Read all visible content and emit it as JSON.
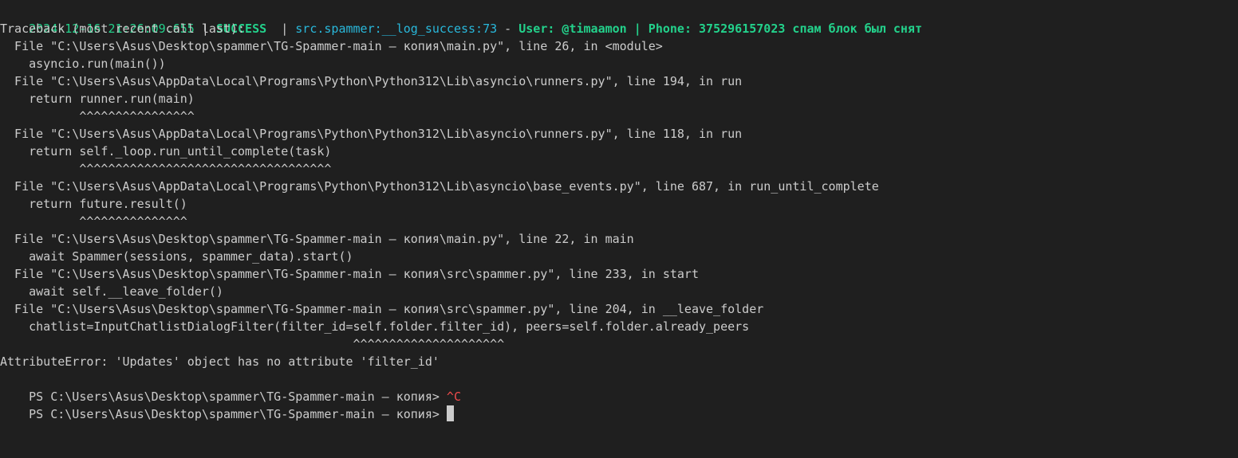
{
  "log": {
    "timestamp": "2024-12-16 21:26:09.655",
    "sep1": " | ",
    "level": "SUCCESS",
    "sep2": "  | ",
    "source": "src.spammer:__log_success:73",
    "dash": " - ",
    "message": "User: @timaamon | Phone: 375296157023 спам блок был снят"
  },
  "traceback": {
    "header": "Traceback (most recent call last):",
    "frames": [
      {
        "file": "  File \"C:\\Users\\Asus\\Desktop\\spammer\\TG-Spammer-main — копия\\main.py\", line 26, in <module>",
        "code": "    asyncio.run(main())",
        "marker": ""
      },
      {
        "file": "  File \"C:\\Users\\Asus\\AppData\\Local\\Programs\\Python\\Python312\\Lib\\asyncio\\runners.py\", line 194, in run",
        "code": "    return runner.run(main)",
        "marker": "           ^^^^^^^^^^^^^^^^"
      },
      {
        "file": "  File \"C:\\Users\\Asus\\AppData\\Local\\Programs\\Python\\Python312\\Lib\\asyncio\\runners.py\", line 118, in run",
        "code": "    return self._loop.run_until_complete(task)",
        "marker": "           ^^^^^^^^^^^^^^^^^^^^^^^^^^^^^^^^^^^"
      },
      {
        "file": "  File \"C:\\Users\\Asus\\AppData\\Local\\Programs\\Python\\Python312\\Lib\\asyncio\\base_events.py\", line 687, in run_until_complete",
        "code": "    return future.result()",
        "marker": "           ^^^^^^^^^^^^^^^"
      },
      {
        "file": "  File \"C:\\Users\\Asus\\Desktop\\spammer\\TG-Spammer-main — копия\\main.py\", line 22, in main",
        "code": "    await Spammer(sessions, spammer_data).start()",
        "marker": ""
      },
      {
        "file": "  File \"C:\\Users\\Asus\\Desktop\\spammer\\TG-Spammer-main — копия\\src\\spammer.py\", line 233, in start",
        "code": "    await self.__leave_folder()",
        "marker": ""
      },
      {
        "file": "  File \"C:\\Users\\Asus\\Desktop\\spammer\\TG-Spammer-main — копия\\src\\spammer.py\", line 204, in __leave_folder",
        "code": "    chatlist=InputChatlistDialogFilter(filter_id=self.folder.filter_id), peers=self.folder.already_peers",
        "marker": "                                                 ^^^^^^^^^^^^^^^^^^^^^"
      }
    ],
    "error": "AttributeError: 'Updates' object has no attribute 'filter_id'"
  },
  "prompt": {
    "path": "PS C:\\Users\\Asus\\Desktop\\spammer\\TG-Spammer-main — копия> ",
    "interrupt": "^C"
  },
  "colors": {
    "background": "#1f1f1f",
    "text": "#cccccc",
    "success": "#23d18b",
    "source": "#29b8db",
    "interrupt": "#f14c4c"
  }
}
